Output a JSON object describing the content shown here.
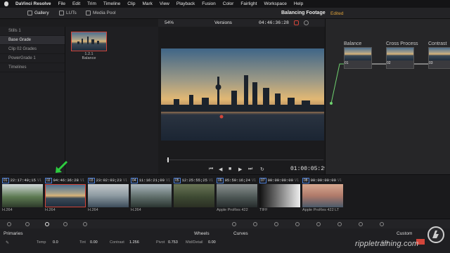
{
  "menubar": {
    "app_name": "DaVinci Resolve",
    "items": [
      "File",
      "Edit",
      "Trim",
      "Timeline",
      "Clip",
      "Mark",
      "View",
      "Playback",
      "Fusion",
      "Color",
      "Fairlight",
      "Workspace",
      "Help"
    ]
  },
  "toolbar": {
    "gallery": "Gallery",
    "luts": "LUTs",
    "media_pool": "Media Pool",
    "zoom": "54%",
    "versions": "Versions",
    "timecode": "04:46:36:28",
    "project_title": "Balancing Footage",
    "project_status": "Edited"
  },
  "gallery": {
    "albums": [
      "Stills 1",
      "Base Grade",
      "Clip 02 Grades",
      "PowerGrade 1",
      "Timelines"
    ],
    "selected_album": "Base Grade",
    "still": {
      "id": "1.2.1",
      "name": "Balance"
    }
  },
  "viewer": {
    "timecode": "01:00:05:29"
  },
  "nodes": [
    {
      "label": "Balance",
      "num": "01"
    },
    {
      "label": "Cross Process",
      "num": "02"
    },
    {
      "label": "Contrast",
      "num": "03"
    }
  ],
  "clips": [
    {
      "num": "01",
      "tc": "22:17:40;15",
      "track": "V1",
      "codec": "H.264"
    },
    {
      "num": "02",
      "tc": "04:46:36:28",
      "track": "V1",
      "codec": "H.264"
    },
    {
      "num": "03",
      "tc": "23:02:03;23",
      "track": "V1",
      "codec": "H.264"
    },
    {
      "num": "04",
      "tc": "11:16:21;00",
      "track": "V1",
      "codec": "H.264"
    },
    {
      "num": "05",
      "tc": "12:25:55;25",
      "track": "V1",
      "codec": ""
    },
    {
      "num": "06",
      "tc": "05:59:16;24",
      "track": "V1",
      "codec": "Apple ProRes 422"
    },
    {
      "num": "07",
      "tc": "00:00:00:00",
      "track": "V1",
      "codec": "TIFF"
    },
    {
      "num": "08",
      "tc": "00:00:00:00",
      "track": "V1",
      "codec": "Apple ProRes 422 LT"
    }
  ],
  "bottom": {
    "primaries": "Primaries",
    "wheels": "Wheels",
    "curves": "Curves",
    "custom": "Custom",
    "params": [
      {
        "label": "Temp",
        "value": "0.0"
      },
      {
        "label": "Tint",
        "value": "0.00"
      },
      {
        "label": "Contrast",
        "value": "1.256"
      },
      {
        "label": "Pivot",
        "value": "0.753"
      },
      {
        "label": "Mid/Detail",
        "value": "0.00"
      }
    ],
    "edit": "Edit"
  },
  "watermark": "rippletraining.com",
  "colors": {
    "accent_red": "#d2453a",
    "accent_orange": "#e0a33a",
    "selection_blue": "#4d7fd6",
    "annotation_green": "#2ecc40"
  }
}
